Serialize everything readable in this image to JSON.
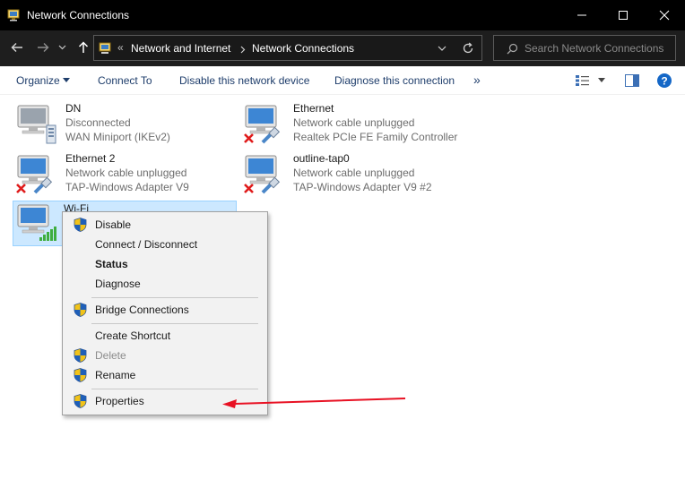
{
  "window": {
    "title": "Network Connections"
  },
  "nav": {
    "overflow": "«",
    "crumbs": [
      "Network and Internet",
      "Network Connections"
    ]
  },
  "search": {
    "placeholder": "Search Network Connections"
  },
  "commands": {
    "organize": "Organize",
    "connect_to": "Connect To",
    "disable": "Disable this network device",
    "diagnose": "Diagnose this connection",
    "more": "»"
  },
  "connections": [
    {
      "name": "DN",
      "status": "Disconnected",
      "device": "WAN Miniport (IKEv2)",
      "badge": "server"
    },
    {
      "name": "Ethernet",
      "status": "Network cable unplugged",
      "device": "Realtek PCIe FE Family Controller",
      "badge": "x-cable"
    },
    {
      "name": "Ethernet 2",
      "status": "Network cable unplugged",
      "device": "TAP-Windows Adapter V9",
      "badge": "x-cable"
    },
    {
      "name": "outline-tap0",
      "status": "Network cable unplugged",
      "device": "TAP-Windows Adapter V9 #2",
      "badge": "x-cable"
    },
    {
      "name": "Wi-Fi",
      "status": "",
      "device": "",
      "badge": "signal-bars"
    }
  ],
  "context_menu": {
    "items": [
      {
        "label": "Disable",
        "shield": true,
        "bold": false,
        "disabled": false
      },
      {
        "label": "Connect / Disconnect",
        "shield": false,
        "bold": false,
        "disabled": false
      },
      {
        "label": "Status",
        "shield": false,
        "bold": true,
        "disabled": false
      },
      {
        "label": "Diagnose",
        "shield": false,
        "bold": false,
        "disabled": false
      },
      {
        "label": "Bridge Connections",
        "shield": true,
        "bold": false,
        "disabled": false
      },
      {
        "label": "Create Shortcut",
        "shield": false,
        "bold": false,
        "disabled": false
      },
      {
        "label": "Delete",
        "shield": true,
        "bold": false,
        "disabled": true
      },
      {
        "label": "Rename",
        "shield": true,
        "bold": false,
        "disabled": false
      },
      {
        "label": "Properties",
        "shield": true,
        "bold": false,
        "disabled": false
      }
    ]
  },
  "colors": {
    "accent": "#0063b1",
    "annotation_arrow": "#e81123",
    "selection": "#cce8ff"
  }
}
